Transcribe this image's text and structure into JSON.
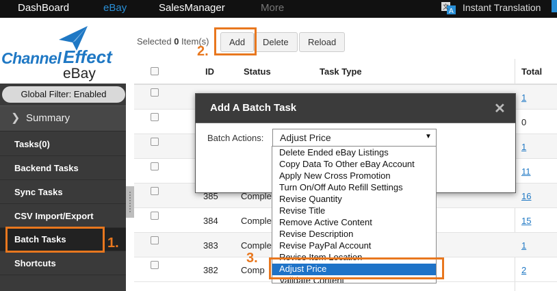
{
  "topnav": {
    "tabs": [
      "DashBoard",
      "eBay",
      "SalesManager",
      "More"
    ],
    "active_tab": "eBay",
    "translate_label": "Instant Translation"
  },
  "sidebar": {
    "logo_channel": "Channel",
    "logo_effect": "Effect",
    "logo_ebay": "eBay",
    "global_filter": "Global Filter: Enabled",
    "summary_label": "Summary",
    "items": [
      {
        "label": "Tasks(0)"
      },
      {
        "label": "Backend Tasks"
      },
      {
        "label": "Sync Tasks"
      },
      {
        "label": "CSV Import/Export"
      },
      {
        "label": "Batch Tasks",
        "active": true
      },
      {
        "label": "Shortcuts"
      }
    ]
  },
  "callouts": [
    "1.",
    "2.",
    "3."
  ],
  "toolbar": {
    "selected_prefix": "Selected ",
    "selected_count": "0",
    "selected_suffix": " Item(s)",
    "add_label": "Add",
    "delete_label": "Delete",
    "reload_label": "Reload"
  },
  "table": {
    "headers": {
      "id": "ID",
      "status": "Status",
      "task_type": "Task Type",
      "total": "Total"
    },
    "rows": [
      {
        "id": "",
        "status": "",
        "total": "1"
      },
      {
        "id": "",
        "status": "",
        "total": "0"
      },
      {
        "id": "",
        "status": "",
        "total": "1"
      },
      {
        "id": "",
        "status": "",
        "total": "11"
      },
      {
        "id": "385",
        "status": "Complet",
        "total": "16"
      },
      {
        "id": "384",
        "status": "Complet",
        "total": "15"
      },
      {
        "id": "383",
        "status": "Complet",
        "total": "1"
      },
      {
        "id": "382",
        "status": "Comp",
        "total": "2"
      }
    ]
  },
  "modal": {
    "title": "Add A Batch Task",
    "close": "✕",
    "batch_label": "Batch Actions:",
    "selected_value": "Adjust Price",
    "options": [
      "Delete Ended eBay Listings",
      "Copy Data To Other eBay Account",
      "Apply New Cross Promotion",
      "Turn On/Off Auto Refill Settings",
      "Revise Quantity",
      "Revise Title",
      "Remove Active Content",
      "Revise Description",
      "Revise PayPal Account",
      "Revise Item Location",
      "Adjust Price",
      "Validate Content"
    ],
    "highlighted_option": "Adjust Price"
  },
  "colors": {
    "accent": "#2a8fd6",
    "callout": "#e8771e",
    "selection": "#1e73c8",
    "sidebar_bg": "#3a3a3a"
  }
}
